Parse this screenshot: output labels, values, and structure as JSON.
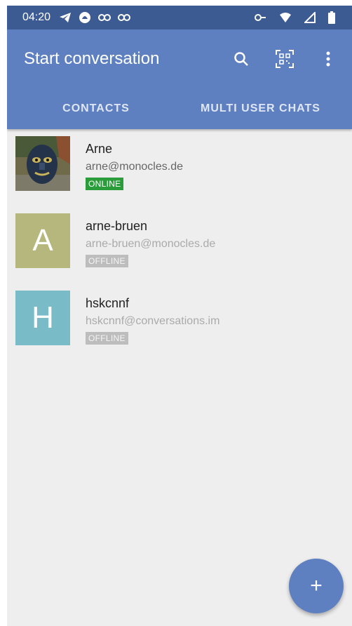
{
  "status_bar": {
    "time": "04:20",
    "left_icons": [
      "telegram-icon",
      "app-notification-icon",
      "link-icon",
      "link-icon"
    ],
    "right_icons": [
      "vpn-key-icon",
      "wifi-icon",
      "cell-signal-icon",
      "battery-icon"
    ]
  },
  "app_bar": {
    "title": "Start conversation",
    "actions": [
      "search-icon",
      "qr-code-icon",
      "overflow-menu-icon"
    ]
  },
  "tabs": [
    {
      "label": "CONTACTS",
      "selected": true
    },
    {
      "label": "MULTI USER CHATS",
      "selected": false
    }
  ],
  "contacts": [
    {
      "name": "Arne",
      "jid": "arne@monocles.de",
      "status": "ONLINE",
      "avatar": "photo-mask"
    },
    {
      "name": "arne-bruen",
      "jid": "arne-bruen@monocles.de",
      "status": "OFFLINE",
      "avatar_letter": "A",
      "avatar_color": "#b5b77c"
    },
    {
      "name": "hskcnnf",
      "jid": "hskcnnf@conversations.im",
      "status": "OFFLINE",
      "avatar_letter": "H",
      "avatar_color": "#79bcc8"
    }
  ],
  "fab": {
    "label": "+"
  },
  "colors": {
    "status_bar": "#3c5b93",
    "primary": "#5f80c0",
    "online": "#2a9d3a",
    "offline": "#bdbdbd",
    "background": "#eeeeee"
  }
}
